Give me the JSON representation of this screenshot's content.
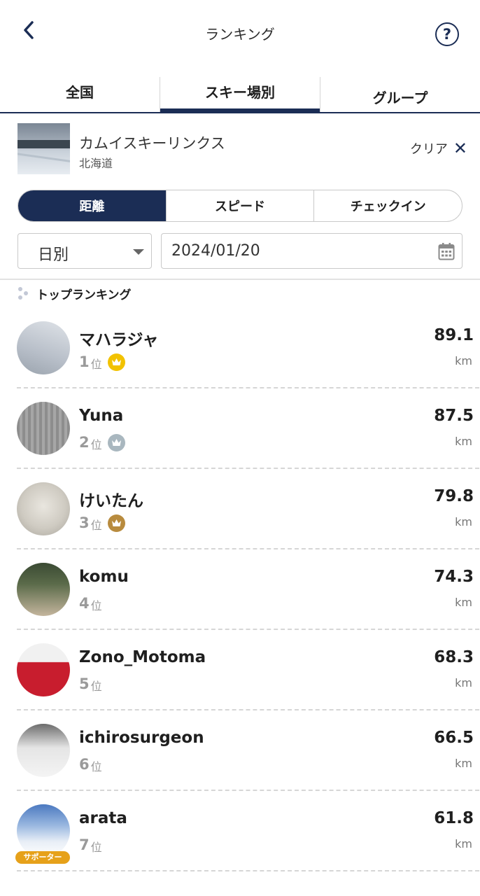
{
  "header": {
    "title": "ランキング",
    "back_icon": "chevron-left-icon",
    "help_label": "?"
  },
  "tabs": [
    {
      "label": "全国",
      "active": false
    },
    {
      "label": "スキー場別",
      "active": true
    },
    {
      "label": "グループ",
      "active": false
    }
  ],
  "resort": {
    "name": "カムイスキーリンクス",
    "region": "北海道",
    "clear_label": "クリア"
  },
  "metric_tabs": [
    {
      "label": "距離",
      "active": true
    },
    {
      "label": "スピード",
      "active": false
    },
    {
      "label": "チェックイン",
      "active": false
    }
  ],
  "filters": {
    "period": "日別",
    "date": "2024/01/20"
  },
  "section": {
    "title": "トップランキング"
  },
  "rank_suffix": "位",
  "colors": {
    "primary": "#1b2d55",
    "gold": "#f2c200",
    "silver": "#a9b7bf",
    "bronze": "#b88b3e",
    "supporter": "#e6a11a"
  },
  "rankings": [
    {
      "name": "マハラジャ",
      "rank": "1",
      "value": "89.1",
      "unit": "km",
      "crown": "gold"
    },
    {
      "name": "Yuna",
      "rank": "2",
      "value": "87.5",
      "unit": "km",
      "crown": "silver"
    },
    {
      "name": "けいたん",
      "rank": "3",
      "value": "79.8",
      "unit": "km",
      "crown": "bronze"
    },
    {
      "name": "komu",
      "rank": "4",
      "value": "74.3",
      "unit": "km"
    },
    {
      "name": "Zono_Motoma",
      "rank": "5",
      "value": "68.3",
      "unit": "km"
    },
    {
      "name": "ichirosurgeon",
      "rank": "6",
      "value": "66.5",
      "unit": "km"
    },
    {
      "name": "arata",
      "rank": "7",
      "value": "61.8",
      "unit": "km",
      "badge": "サポーター"
    }
  ]
}
